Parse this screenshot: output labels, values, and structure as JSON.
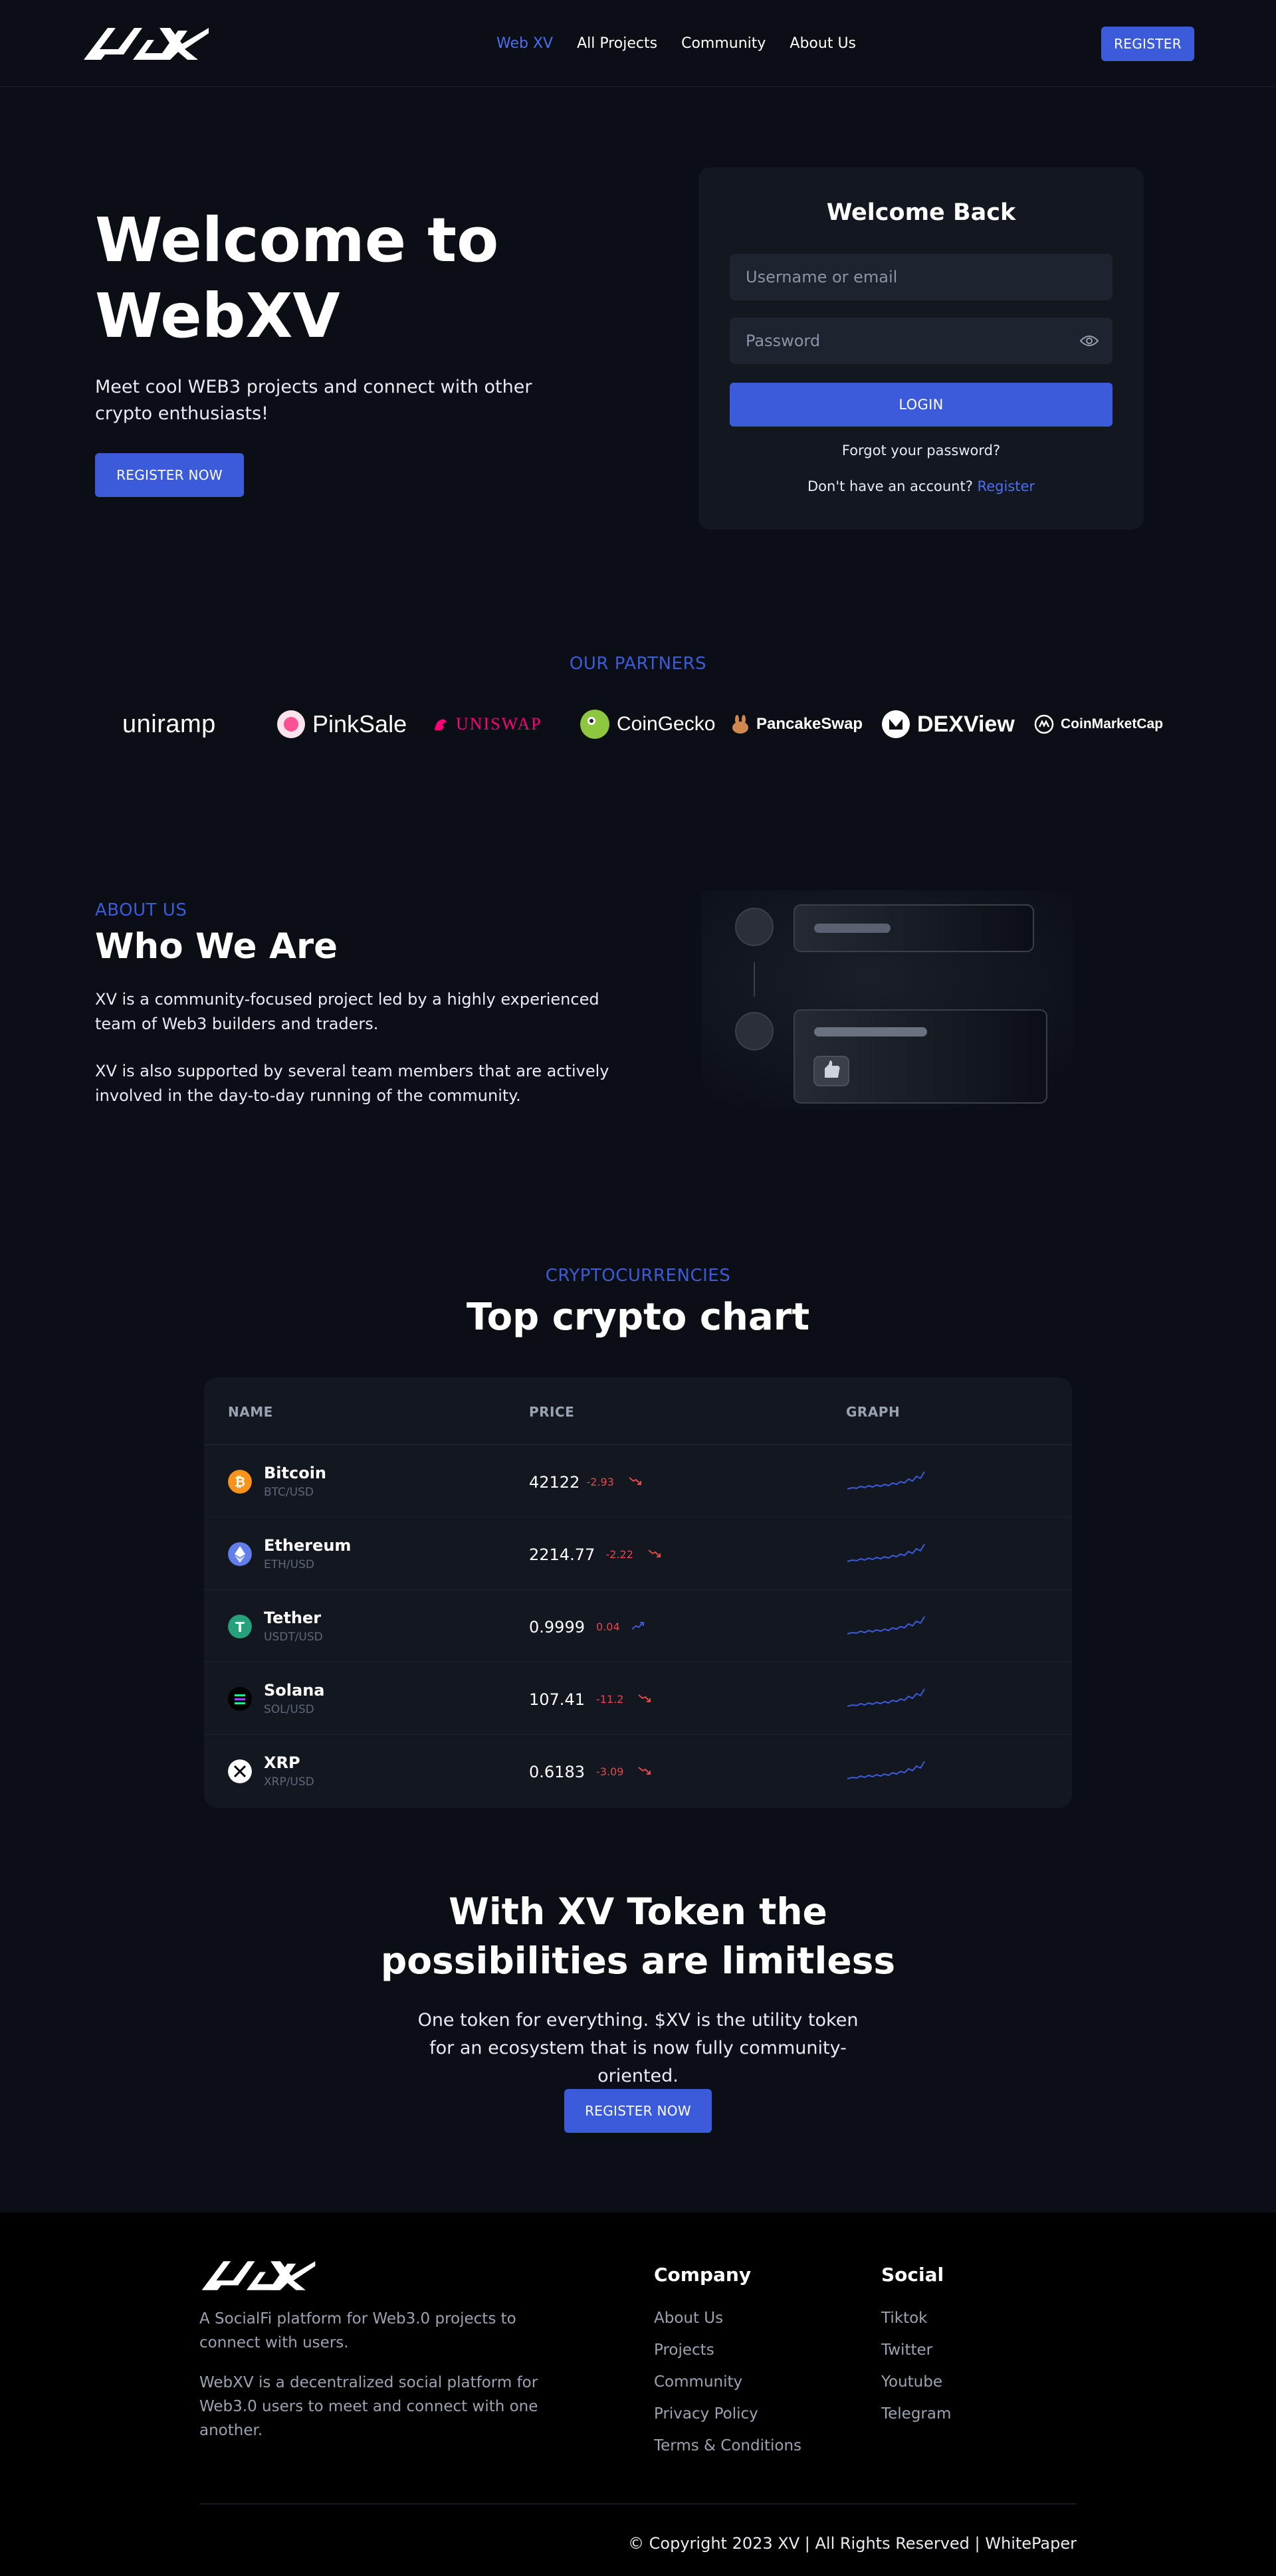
{
  "nav": {
    "links": [
      "Web XV",
      "All Projects",
      "Community",
      "About Us"
    ],
    "register": "REGISTER"
  },
  "hero": {
    "title_line1": "Welcome to",
    "title_line2": "WebXV",
    "subtitle": "Meet cool WEB3 projects and connect with other crypto enthusiasts!",
    "cta": "REGISTER NOW"
  },
  "login": {
    "title": "Welcome Back",
    "username_placeholder": "Username or email",
    "password_placeholder": "Password",
    "login_button": "LOGIN",
    "forgot": "Forgot your password?",
    "no_account": "Don't have an account?",
    "register_link": "Register"
  },
  "partners": {
    "label": "OUR PARTNERS",
    "items": [
      "uniramp",
      "PinkSale",
      "UNISWAP",
      "CoinGecko",
      "PancakeSwap",
      "DEXView",
      "CoinMarketCap"
    ]
  },
  "about": {
    "eyebrow": "ABOUT US",
    "title": "Who We Are",
    "p1": "XV is a community-focused project led by a highly experienced team of Web3 builders and traders.",
    "p2": "XV is also supported by several team members that are actively involved in the day-to-day running of the community."
  },
  "crypto": {
    "eyebrow": "CRYPTOCURRENCIES",
    "title": "Top crypto chart",
    "headers": {
      "name": "NAME",
      "price": "PRICE",
      "graph": "GRAPH"
    },
    "rows": [
      {
        "name": "Bitcoin",
        "pair": "BTC/USD",
        "price": "42122",
        "change": "-2.93",
        "trend": "down",
        "color": "#f7931a",
        "icon": "bitcoin-icon"
      },
      {
        "name": "Ethereum",
        "pair": "ETH/USD",
        "price": "2214.77",
        "change": "-2.22",
        "trend": "down",
        "color": "#627eea",
        "icon": "ethereum-icon"
      },
      {
        "name": "Tether",
        "pair": "USDT/USD",
        "price": "0.9999",
        "change": "0.04",
        "trend": "up",
        "color": "#26a17b",
        "icon": "tether-icon"
      },
      {
        "name": "Solana",
        "pair": "SOL/USD",
        "price": "107.41",
        "change": "-11.2",
        "trend": "down",
        "color": "#14f195",
        "icon": "solana-icon"
      },
      {
        "name": "XRP",
        "pair": "XRP/USD",
        "price": "0.6183",
        "change": "-3.09",
        "trend": "down",
        "color": "#ffffff",
        "icon": "xrp-icon"
      }
    ]
  },
  "token": {
    "title_line1": "With XV Token the",
    "title_line2": "possibilities are limitless",
    "subtitle": "One token for everything. $XV is the utility token for an ecosystem that is now fully community-oriented.",
    "cta": "REGISTER NOW"
  },
  "footer": {
    "desc1": "A SocialFi platform for Web3.0 projects to connect with users.",
    "desc2": "WebXV is a decentralized social platform for Web3.0 users to meet and connect with one another.",
    "company_heading": "Company",
    "company_links": [
      "About Us",
      "Projects",
      "Community",
      "Privacy Policy",
      "Terms & Conditions"
    ],
    "social_heading": "Social",
    "social_links": [
      "Tiktok",
      "Twitter",
      "Youtube",
      "Telegram"
    ],
    "copyright": "© Copyright 2023 XV | All Rights Reserved | WhitePaper"
  },
  "colors": {
    "background": "#0b0f15",
    "card": "#121720",
    "accent": "#3b5bdb",
    "negative": "#e5484d"
  }
}
